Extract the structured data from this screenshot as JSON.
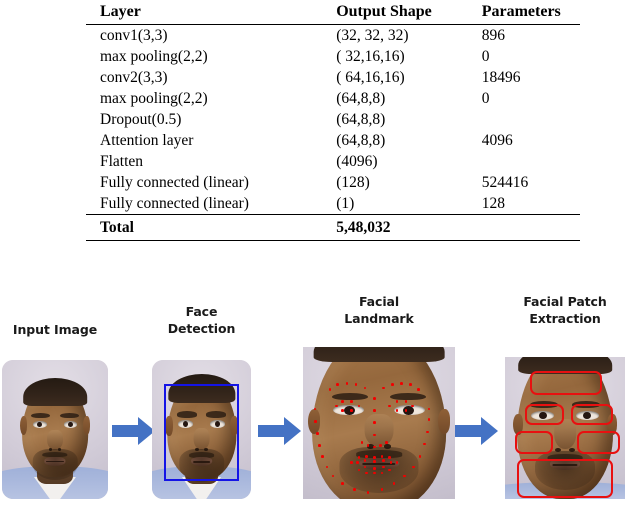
{
  "table": {
    "headers": [
      "Layer",
      "Output Shape",
      "Parameters"
    ],
    "rows": [
      {
        "layer": "conv1(3,3)",
        "shape": "(32, 32, 32)",
        "params": "896"
      },
      {
        "layer": "max  pooling(2,2)",
        "shape": "( 32,16,16)",
        "params": "0"
      },
      {
        "layer": "conv2(3,3)",
        "shape": "( 64,16,16)",
        "params": "18496"
      },
      {
        "layer": "max  pooling(2,2)",
        "shape": "(64,8,8)",
        "params": "0"
      },
      {
        "layer": "Dropout(0.5)",
        "shape": "(64,8,8)",
        "params": ""
      },
      {
        "layer": "Attention  layer",
        "shape": "(64,8,8)",
        "params": "4096"
      },
      {
        "layer": "Flatten",
        "shape": "(4096)",
        "params": ""
      },
      {
        "layer": "Fully connected  (linear)",
        "shape": "(128)",
        "params": "524416"
      },
      {
        "layer": "Fully connected  (linear)",
        "shape": "(1)",
        "params": "128"
      }
    ],
    "total": {
      "layer": "Total",
      "shape": "5,48,032",
      "params": ""
    }
  },
  "pipeline": {
    "stages": [
      {
        "label_line1": "Input Image",
        "label_line2": ""
      },
      {
        "label_line1": "Face",
        "label_line2": "Detection"
      },
      {
        "label_line1": "Facial",
        "label_line2": "Landmark"
      },
      {
        "label_line1": "Facial Patch",
        "label_line2": "Extraction"
      }
    ],
    "arrow_count": 3
  },
  "colors": {
    "arrow": "#4472c4",
    "detection_box": "#1414e6",
    "patch_box": "#e81010",
    "landmark_dot": "#f20000",
    "rule": "#000000",
    "photo_background": "#d9d3de"
  },
  "annotations": {
    "detection_box_label": "face-bounding-box",
    "landmark_points_label": "facial-landmark-points",
    "patch_labels": [
      "forehead",
      "left-eye",
      "right-eye",
      "left-cheek",
      "right-cheek",
      "mouth-chin"
    ]
  }
}
